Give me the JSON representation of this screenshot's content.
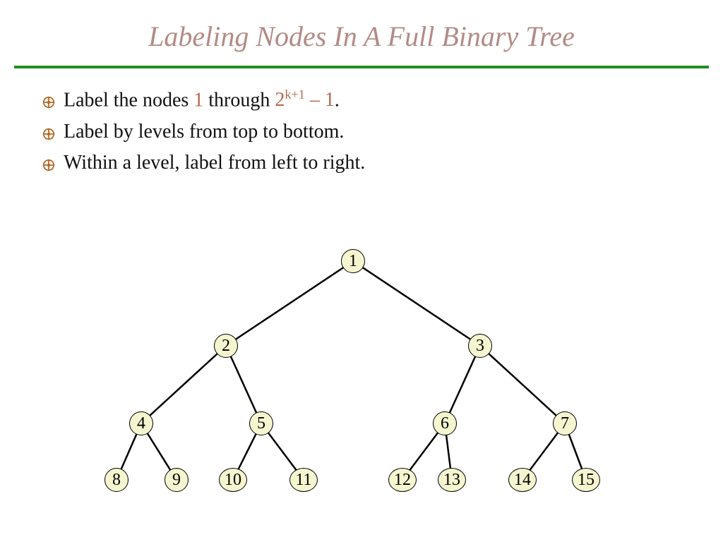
{
  "title": "Labeling Nodes In A Full Binary Tree",
  "bullets": {
    "b1_pre": "Label the nodes ",
    "b1_n1": "1",
    "b1_mid": " through ",
    "b1_base": "2",
    "b1_exp": "k+1",
    "b1_suf": " – 1",
    "b1_end": ".",
    "b2": "Label by levels from top to bottom.",
    "b3": "Within a level, label from left to right."
  },
  "tree": {
    "nodes": {
      "n1": "1",
      "n2": "2",
      "n3": "3",
      "n4": "4",
      "n5": "5",
      "n6": "6",
      "n7": "7",
      "n8": "8",
      "n9": "9",
      "n10": "10",
      "n11": "11",
      "n12": "12",
      "n13": "13",
      "n14": "14",
      "n15": "15"
    }
  },
  "colors": {
    "title": "#b28b86",
    "rule": "#1f8f1f",
    "bulletIcon": "#b56a27",
    "accent": "#b06a4a",
    "nodeFill": "#f5f5cf"
  }
}
